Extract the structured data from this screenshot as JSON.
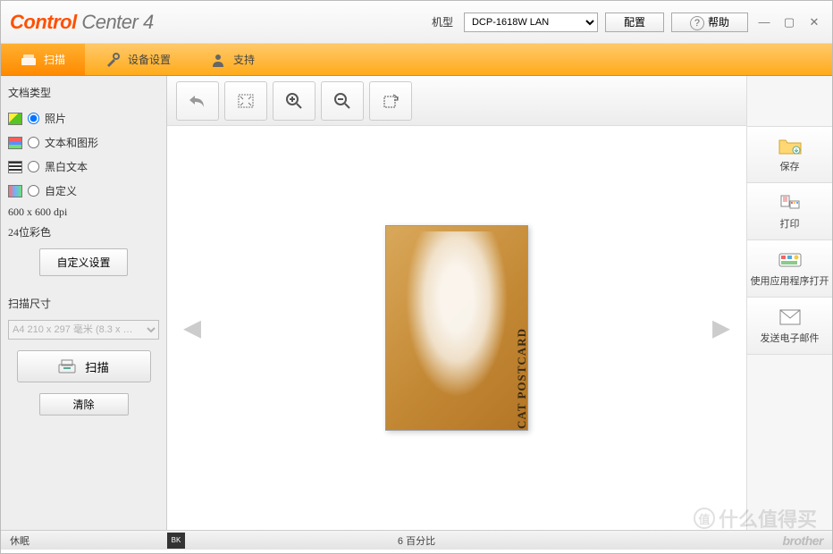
{
  "header": {
    "logo_main": "Control",
    "logo_sub": "Center 4",
    "model_label": "机型",
    "model_value": "DCP-1618W LAN",
    "config_btn": "配置",
    "help_btn": "帮助"
  },
  "tabs": {
    "scan": "扫描",
    "device": "设备设置",
    "support": "支持"
  },
  "sidebar": {
    "doc_type_title": "文档类型",
    "options": {
      "photo": "照片",
      "text_graphics": "文本和图形",
      "bw_text": "黑白文本",
      "custom": "自定义"
    },
    "resolution": "600 x 600 dpi",
    "color_depth": "24位彩色",
    "custom_settings_btn": "自定义设置",
    "scan_size_title": "扫描尺寸",
    "scan_size_value": "A4 210 x 297 毫米 (8.3 x …",
    "scan_btn": "扫描",
    "clear_btn": "清除"
  },
  "preview": {
    "postcard_text": "CAT POSTCARD"
  },
  "rightbar": {
    "save": "保存",
    "print": "打印",
    "open_app": "使用应用程序打开",
    "email": "发送电子邮件"
  },
  "status": {
    "left": "休眠",
    "center": "6 百分比",
    "ink": "BK",
    "brand": "brother"
  },
  "watermark": {
    "badge": "值",
    "text": "什么值得买"
  }
}
